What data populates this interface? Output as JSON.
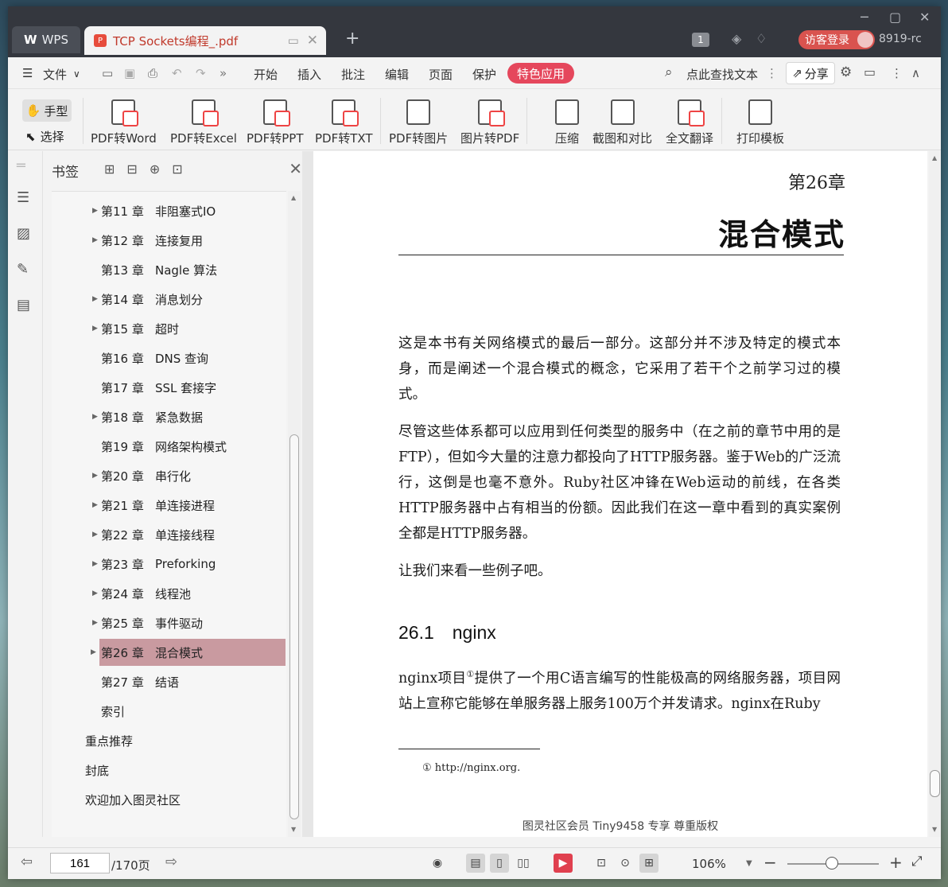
{
  "titlebar": {
    "app_tab": "WPS",
    "doc_tab": "TCP Sockets编程_.pdf",
    "page_badge": "1",
    "guest_login": "访客登录",
    "version": "8919-rc"
  },
  "menubar": {
    "file": "文件",
    "items": [
      "开始",
      "插入",
      "批注",
      "编辑",
      "页面",
      "保护"
    ],
    "special": "特色应用",
    "search": "点此查找文本",
    "share": "分享"
  },
  "ribbon": {
    "hand": "手型",
    "select": "选择",
    "buttons": [
      "PDF转Word",
      "PDF转Excel",
      "PDF转PPT",
      "PDF转TXT",
      "PDF转图片",
      "图片转PDF",
      "压缩",
      "截图和对比",
      "全文翻译",
      "打印模板"
    ]
  },
  "bookmarks": {
    "title": "书签",
    "items": [
      {
        "num": "第11 章",
        "label": "非阻塞式IO"
      },
      {
        "num": "第12 章",
        "label": "连接复用"
      },
      {
        "num": "第13 章",
        "label": "Nagle 算法"
      },
      {
        "num": "第14 章",
        "label": "消息划分"
      },
      {
        "num": "第15 章",
        "label": "超时"
      },
      {
        "num": "第16 章",
        "label": "DNS 查询"
      },
      {
        "num": "第17 章",
        "label": "SSL 套接字"
      },
      {
        "num": "第18 章",
        "label": "紧急数据"
      },
      {
        "num": "第19 章",
        "label": "网络架构模式"
      },
      {
        "num": "第20 章",
        "label": "串行化"
      },
      {
        "num": "第21 章",
        "label": "单连接进程"
      },
      {
        "num": "第22 章",
        "label": "单连接线程"
      },
      {
        "num": "第23 章",
        "label": "Preforking"
      },
      {
        "num": "第24 章",
        "label": "线程池"
      },
      {
        "num": "第25 章",
        "label": "事件驱动"
      },
      {
        "num": "第26 章",
        "label": "混合模式"
      },
      {
        "num": "第27 章",
        "label": "结语"
      }
    ],
    "index": "索引",
    "top_items": [
      "重点推荐",
      "封底",
      "欢迎加入图灵社区"
    ]
  },
  "page": {
    "chapter": "第26章",
    "title": "混合模式",
    "para1": "这是本书有关网络模式的最后一部分。这部分并不涉及特定的模式本身，而是阐述一个混合模式的概念，它采用了若干个之前学习过的模式。",
    "para2": "尽管这些体系都可以应用到任何类型的服务中（在之前的章节中用的是FTP），但如今大量的注意力都投向了HTTP服务器。鉴于Web的广泛流行，这倒是也毫不意外。Ruby社区冲锋在Web运动的前线，在各类HTTP服务器中占有相当的份额。因此我们在这一章中看到的真实案例全都是HTTP服务器。",
    "para3": "让我们来看一些例子吧。",
    "section": "26.1　nginx",
    "para4a": "nginx项目",
    "para4_sup": "①",
    "para4b": "提供了一个用C语言编写的性能极高的网络服务器，项目网站上宣称它能够在单服务器上服务100万个并发请求。nginx在Ruby",
    "footnote": "①  http://nginx.org.",
    "watermark": "图灵社区会员 Tiny9458 专享 尊重版权"
  },
  "status": {
    "page_current": "161",
    "page_total": "/170页",
    "zoom": "106%"
  }
}
